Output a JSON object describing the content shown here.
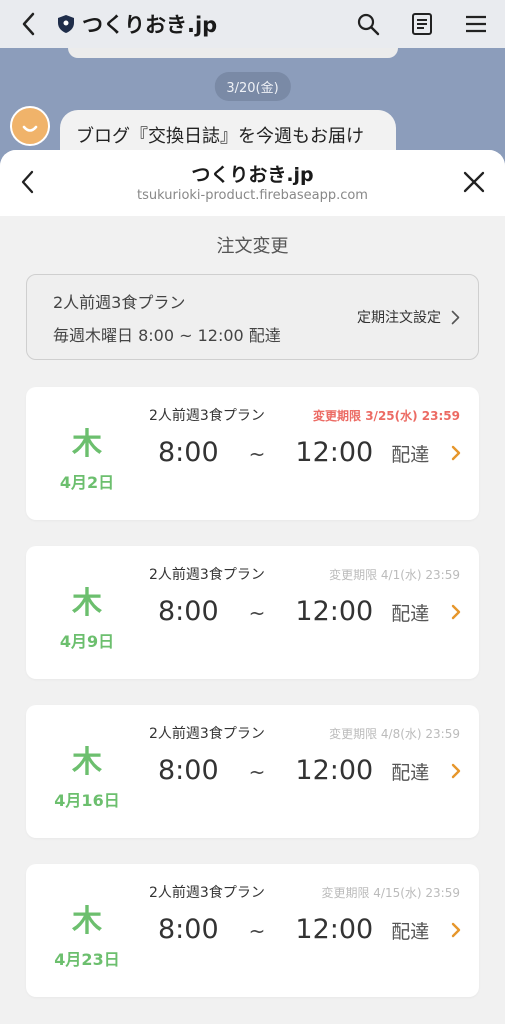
{
  "chat": {
    "title": "つくりおき.jp",
    "date_label": "3/20(金)",
    "message_preview": "ブログ『交換日誌』を今週もお届け"
  },
  "sheet": {
    "title": "つくりおき.jp",
    "url": "tsukurioki-product.firebaseapp.com"
  },
  "page": {
    "heading": "注文変更"
  },
  "plan": {
    "name": "2人前週3食プラン",
    "schedule": "毎週木曜日 8:00 ~ 12:00 配達",
    "link_label": "定期注文設定"
  },
  "deliveries": [
    {
      "weekday": "木",
      "date": "4月2日",
      "plan": "2人前週3食プラン",
      "deadline": "変更期限 3/25(水) 23:59",
      "start": "8:00",
      "tilde": "~",
      "end": "12:00",
      "delivery": "配達"
    },
    {
      "weekday": "木",
      "date": "4月9日",
      "plan": "2人前週3食プラン",
      "deadline": "変更期限 4/1(水) 23:59",
      "start": "8:00",
      "tilde": "~",
      "end": "12:00",
      "delivery": "配達"
    },
    {
      "weekday": "木",
      "date": "4月16日",
      "plan": "2人前週3食プラン",
      "deadline": "変更期限 4/8(水) 23:59",
      "start": "8:00",
      "tilde": "~",
      "end": "12:00",
      "delivery": "配達"
    },
    {
      "weekday": "木",
      "date": "4月23日",
      "plan": "2人前週3食プラン",
      "deadline": "変更期限 4/15(水) 23:59",
      "start": "8:00",
      "tilde": "~",
      "end": "12:00",
      "delivery": "配達"
    }
  ],
  "icons": {
    "back": "chevron-left-icon",
    "shield": "shield-icon",
    "search": "search-icon",
    "notes": "note-icon",
    "menu": "hamburger-menu-icon",
    "close": "close-icon",
    "link_chevron": "chevron-right-icon",
    "card_arrow": "chevron-right-icon"
  },
  "colors": {
    "green": "#6cbf6e",
    "urgent_red": "#ec6b64",
    "arrow_orange": "#e6962c",
    "chat_bg": "#8c9dbb"
  }
}
